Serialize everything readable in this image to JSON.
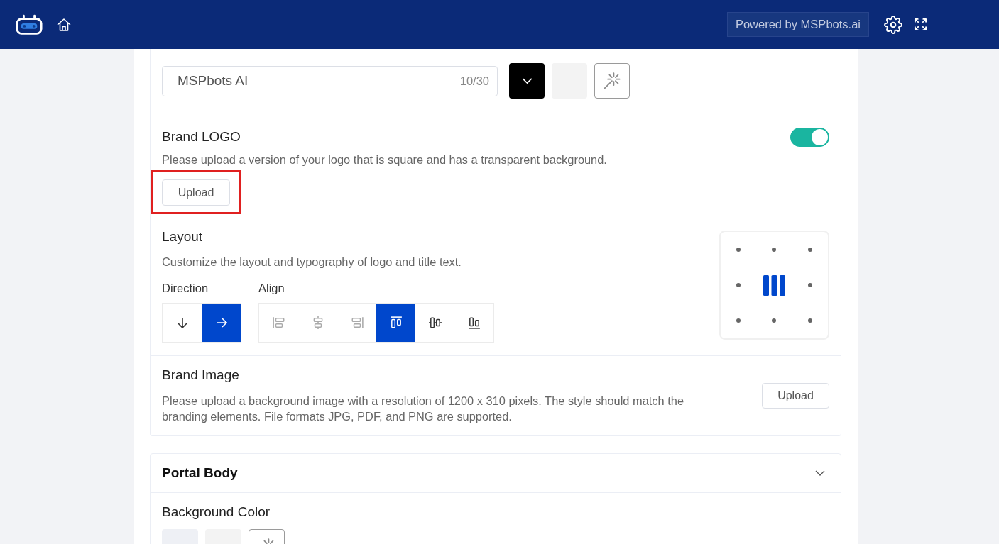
{
  "header": {
    "powered_by": "Powered by MSPbots.ai"
  },
  "title_section": {
    "field": {
      "value": "MSPbots AI",
      "counter": "10/30"
    },
    "swatches": [
      {
        "kind": "picker",
        "color": "#000000"
      },
      {
        "kind": "swatch",
        "color": "#f3f3f3"
      },
      {
        "kind": "custom"
      }
    ]
  },
  "brand_logo": {
    "title": "Brand LOGO",
    "on": true,
    "description": "Please upload a version of your logo that is square and has a transparent background.",
    "upload_button": "Upload",
    "highlighted": true
  },
  "layout": {
    "title": "Layout",
    "description": "Customize the layout and typography of logo and title text.",
    "direction": {
      "label": "Direction",
      "options": [
        {
          "kind": "down",
          "selected": false
        },
        {
          "kind": "right",
          "selected": true
        }
      ]
    },
    "align": {
      "label": "Align",
      "options": [
        {
          "kind": "left",
          "selected": false,
          "disabled": true
        },
        {
          "kind": "center",
          "selected": false,
          "disabled": true
        },
        {
          "kind": "right",
          "selected": false,
          "disabled": true
        },
        {
          "kind": "top",
          "selected": true,
          "disabled": false
        },
        {
          "kind": "middle",
          "selected": false,
          "disabled": false
        },
        {
          "kind": "bottom",
          "selected": false,
          "disabled": false
        }
      ]
    },
    "preview": {
      "cells": [
        {
          "selected": false
        },
        {
          "selected": false
        },
        {
          "selected": false
        },
        {
          "selected": false
        },
        {
          "selected": true
        },
        {
          "selected": false
        },
        {
          "selected": false
        },
        {
          "selected": false
        },
        {
          "selected": false
        }
      ]
    }
  },
  "brand_image": {
    "title": "Brand Image",
    "description": "Please upload a background image with a resolution of 1200 x 310 pixels. The style should match the branding elements. File formats JPG, PDF, and PNG are supported.",
    "upload_button": "Upload"
  },
  "portal_body": {
    "title": "Portal Body",
    "expanded": true,
    "background_color": {
      "label": "Background Color",
      "swatches": [
        {
          "kind": "picker",
          "color": "#eef0f5"
        },
        {
          "kind": "swatch",
          "color": "#f3f3f3"
        },
        {
          "kind": "custom"
        }
      ]
    }
  }
}
